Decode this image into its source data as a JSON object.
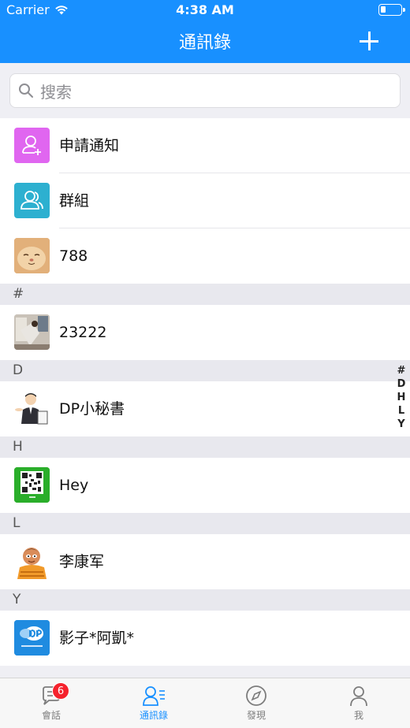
{
  "status": {
    "carrier": "Carrier",
    "time": "4:38 AM"
  },
  "nav": {
    "title": "通訊錄"
  },
  "search": {
    "placeholder": "搜索"
  },
  "top_items": [
    {
      "name": "申請通知",
      "icon": "user-add-icon",
      "color": "#e066f0"
    },
    {
      "name": "群組",
      "icon": "group-icon",
      "color": "#2db0d0"
    },
    {
      "name": "788",
      "icon": "cat-avatar"
    }
  ],
  "sections": [
    {
      "letter": "#",
      "contacts": [
        {
          "name": "23222"
        }
      ]
    },
    {
      "letter": "D",
      "contacts": [
        {
          "name": "DP小秘書"
        }
      ]
    },
    {
      "letter": "H",
      "contacts": [
        {
          "name": "Hey"
        }
      ]
    },
    {
      "letter": "L",
      "contacts": [
        {
          "name": "李康军"
        }
      ]
    },
    {
      "letter": "Y",
      "contacts": [
        {
          "name": "影子*阿凱*"
        }
      ]
    }
  ],
  "index": [
    "#",
    "D",
    "H",
    "L",
    "Y"
  ],
  "tabs": [
    {
      "label": "會話",
      "badge": "6"
    },
    {
      "label": "通訊錄"
    },
    {
      "label": "發現"
    },
    {
      "label": "我"
    }
  ],
  "colors": {
    "brand": "#1890ff",
    "badge": "#f5222d"
  }
}
